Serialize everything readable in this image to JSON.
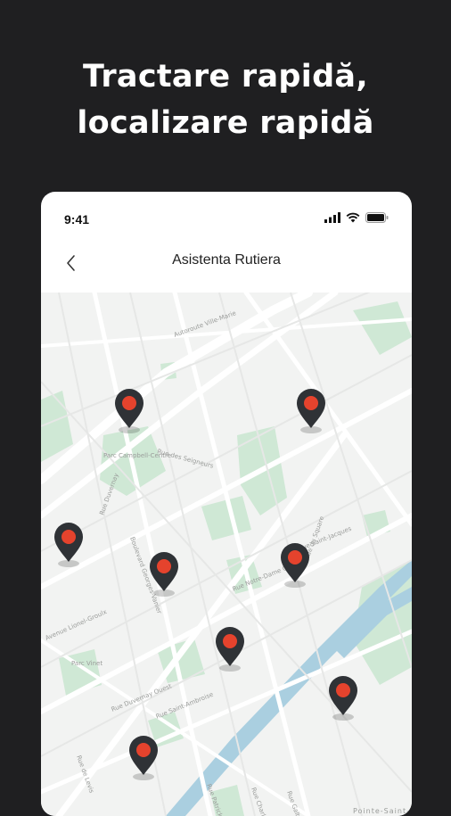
{
  "headline": {
    "line1": "Tractare rapidă,",
    "line2": "localizare rapidă"
  },
  "status_bar": {
    "time": "9:41",
    "icons": [
      "signal-icon",
      "wifi-icon",
      "battery-icon"
    ]
  },
  "nav": {
    "back_icon": "chevron-left-icon",
    "title": "Asistenta Rutiera"
  },
  "map": {
    "street_labels": [
      "Autoroute Ville-Marie",
      "Parc Campbell-Centre",
      "Rue des Seigneurs",
      "Rue Duvernay",
      "Boulevard Georges-Vanier",
      "Rue Notre-Dame Ouest",
      "Rue Saint-Jacques",
      "Avenue Lionel-Groulx",
      "Parc Vinet",
      "Rue Duvernay Ouest",
      "Rue Saint-Ambroise",
      "Rue de Levis",
      "Rue Patrick",
      "Rue Charlevoix",
      "Rue Galt",
      "Pointe-Saint-Charles",
      "Rue du Square"
    ],
    "pin_count": 8,
    "colors": {
      "pin_body": "#2f3236",
      "pin_dot": "#e5432d",
      "park": "#cfe8d5",
      "water": "#aacfe0"
    }
  }
}
